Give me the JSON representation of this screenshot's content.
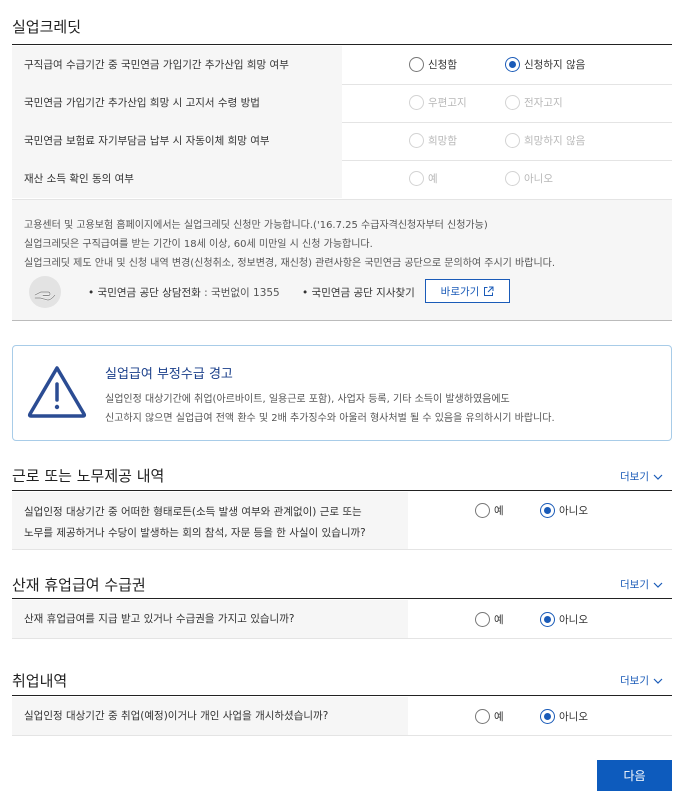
{
  "credit": {
    "title": "실업크레딧",
    "rows": [
      {
        "question": "구직급여 수급기간 중 국민연금 가입기간 추가산입 희망 여부",
        "opt1": "신청함",
        "opt2": "신청하지 않음",
        "selected": 2,
        "disabled": false
      },
      {
        "question": "국민연금 가입기간 추가산입 희망 시 고지서 수령 방법",
        "opt1": "우편고지",
        "opt2": "전자고지",
        "selected": 0,
        "disabled": true
      },
      {
        "question": "국민연금 보험료 자기부담금 납부 시 자동이체 희망 여부",
        "opt1": "희망함",
        "opt2": "희망하지 않음",
        "selected": 0,
        "disabled": true
      },
      {
        "question": "재산 소득 확인 동의 여부",
        "opt1": "예",
        "opt2": "아니오",
        "selected": 0,
        "disabled": true
      }
    ],
    "notice": {
      "line1": "고용센터 및 고용보험 홈페이지에서는 실업크레딧 신청만 가능합니다.('16.7.25 수급자격신청자부터 신청가능)",
      "line2": "실업크레딧은 구직급여를 받는 기간이 18세 이상, 60세 미만일 시 신청 가능합니다.",
      "line3": "실업크레딧 제도 안내 및 신청 내역 변경(신청취소, 정보변경, 재신청) 관련사항은 국민연금 공단으로 문의하여 주시기 바랍니다.",
      "phone_label": "국민연금 공단 상담전화",
      "phone_value": ": 국번없이 1355",
      "branch_label": "국민연금 공단 지사찾기",
      "go_button": "바로가기"
    }
  },
  "warning": {
    "title": "실업급여 부정수급 경고",
    "line1": "실업인정 대상기간에 취업(아르바이트, 일용근로 포함), 사업자 등록, 기타 소득이 발생하였음에도",
    "line2": "신고하지 않으면 실업급여 전액 환수 및 2배 추가징수와 아울러 형사처벌 될 수 있음을 유의하시기 바랍니다."
  },
  "labor": {
    "title": "근로 또는 노무제공 내역",
    "more": "더보기",
    "q_line1": "실업인정 대상기간 중 어떠한 형태로든(소득 발생 여부와 관계없이) 근로 또는",
    "q_line2": "노무를 제공하거나 수당이 발생하는 회의 참석, 자문 등을 한 사실이 있습니까?",
    "yes": "예",
    "no": "아니오",
    "selected": "no"
  },
  "injury": {
    "title": "산재 휴업급여 수급권",
    "more": "더보기",
    "question": "산재 휴업급여를 지급 받고 있거나 수급권을 가지고 있습니까?",
    "yes": "예",
    "no": "아니오",
    "selected": "no"
  },
  "employment": {
    "title": "취업내역",
    "more": "더보기",
    "question": "실업인정 대상기간 중 취업(예정)이거나 개인 사업을 개시하셨습니까?",
    "yes": "예",
    "no": "아니오",
    "selected": "no"
  },
  "next_button": "다음",
  "colors": {
    "accent": "#1a5bb8",
    "next_button": "#0d5bbd",
    "warning_title": "#1a3f8a",
    "warning_border": "#a8cce8",
    "label_bg": "#f6f6f6"
  }
}
